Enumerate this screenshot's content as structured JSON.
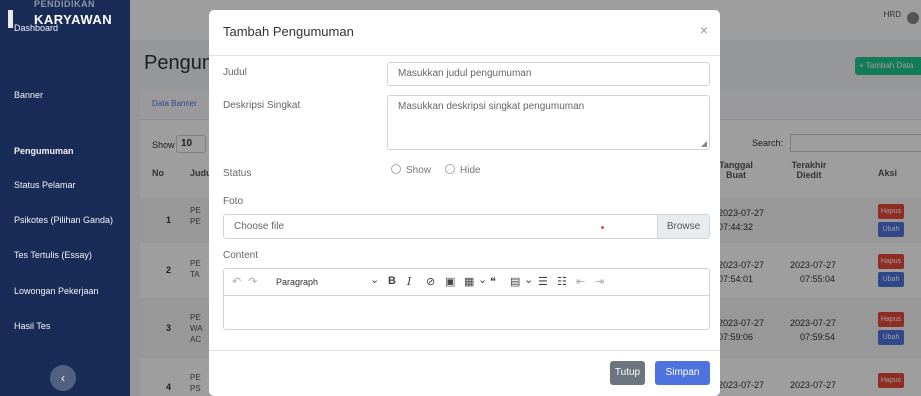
{
  "sidebar": {
    "brand_top": "PENDIDIKAN",
    "brand_name": "KARYAWAN",
    "items": [
      {
        "label": "Dashboard"
      },
      {
        "label": "Banner"
      },
      {
        "label": "Pengumuman"
      },
      {
        "label": "Status Pelamar"
      },
      {
        "label": "Psikotes (Pilihan Ganda)"
      },
      {
        "label": "Tes Tertulis (Essay)"
      },
      {
        "label": "Lowongan Pekerjaan"
      },
      {
        "label": "Hasil Tes"
      }
    ],
    "toggle_glyph": "‹"
  },
  "topbar": {
    "user": "HRD"
  },
  "page": {
    "title": "Pengumuman",
    "add_button": "+ Tambah Data",
    "breadcrumb": "Data Banner",
    "show_label": "Show",
    "show_value": "10",
    "search_label": "Search:",
    "columns": {
      "no": "No",
      "judul": "Judul",
      "tanggal_buat": "Tanggal Buat",
      "terakhir_diedit": "Terakhir Diedit",
      "aksi": "Aksi"
    },
    "rows": [
      {
        "no": "1",
        "judul_1": "PE",
        "judul_2": "PE",
        "judul_3": "",
        "created_date": "2023-07-27",
        "created_time": "07:44:32",
        "edited_date": "",
        "edited_time": "",
        "hapus": "Hapus",
        "ubah": "Ubah"
      },
      {
        "no": "2",
        "judul_1": "PE",
        "judul_2": "TA",
        "judul_3": "",
        "created_date": "2023-07-27",
        "created_time": "07:54:01",
        "edited_date": "2023-07-27",
        "edited_time": "07:55:04",
        "hapus": "Hapus",
        "ubah": "Ubah"
      },
      {
        "no": "3",
        "judul_1": "PE",
        "judul_2": "WA",
        "judul_3": "AC",
        "created_date": "2023-07-27",
        "created_time": "07:59:06",
        "edited_date": "2023-07-27",
        "edited_time": "07:59:54",
        "hapus": "Hapus",
        "ubah": "Ubah"
      },
      {
        "no": "4",
        "judul_1": "PE",
        "judul_2": "PS",
        "judul_3": "",
        "created_date": "2023-07-27",
        "created_time": "",
        "edited_date": "2023-07-27",
        "edited_time": "",
        "hapus": "Hapus",
        "ubah": ""
      }
    ]
  },
  "modal": {
    "title": "Tambah Pengumuman",
    "close_glyph": "×",
    "judul_label": "Judul",
    "judul_placeholder": "Masukkan judul pengumuman",
    "deskripsi_label": "Deskripsi Singkat",
    "deskripsi_placeholder": "Masukkan deskripsi singkat pengumuman",
    "status_label": "Status",
    "status_options": [
      "Show",
      "Hide"
    ],
    "foto_label": "Foto",
    "file_placeholder": "Choose file",
    "browse_label": "Browse",
    "content_label": "Content",
    "editor": {
      "undo": "↶",
      "redo": "↷",
      "block_format": "Paragraph",
      "dropdown": "⌄",
      "bold": "B",
      "italic": "I",
      "link": "⊘",
      "image": "▣",
      "table": "▦",
      "quote": "❝",
      "media": "▤",
      "bullet_list": "☰",
      "numbered_list": "☷",
      "outdent": "⇤",
      "indent": "⇥"
    },
    "tutup_label": "Tutup",
    "simpan_label": "Simpan"
  },
  "colors": {
    "sidebar": "#2f4f9e",
    "primary": "#4e73df",
    "danger": "#e74a3b",
    "success": "#1cc88a",
    "secondary": "#6c757d"
  }
}
